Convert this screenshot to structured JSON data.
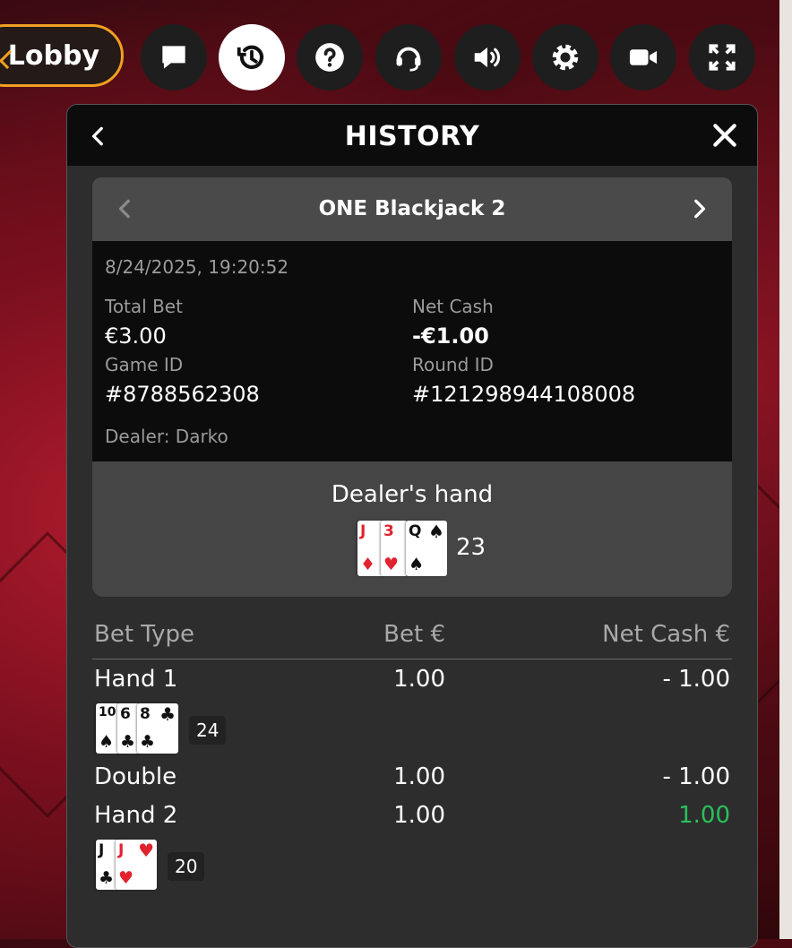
{
  "topbar": {
    "lobby_label": "Lobby",
    "buttons": [
      {
        "icon": "chat-icon"
      },
      {
        "icon": "history-icon",
        "active": true
      },
      {
        "icon": "help-icon"
      },
      {
        "icon": "headset-icon"
      },
      {
        "icon": "volume-icon"
      },
      {
        "icon": "settings-icon"
      },
      {
        "icon": "video-icon"
      },
      {
        "icon": "fullscreen-icon"
      }
    ]
  },
  "panel": {
    "title": "HISTORY",
    "game_name": "ONE Blackjack 2",
    "datetime": "8/24/2025, 19:20:52",
    "total_bet_label": "Total Bet",
    "total_bet_value": "€3.00",
    "net_cash_label": "Net Cash",
    "net_cash_value": "-€1.00",
    "game_id_label": "Game ID",
    "game_id_value": "#8788562308",
    "round_id_label": "Round ID",
    "round_id_value": "#121298944108008",
    "dealer": "Dealer: Darko",
    "dealer_hand_title": "Dealer's hand",
    "dealer_cards": [
      {
        "rank": "J",
        "suit": "♦",
        "color": "red"
      },
      {
        "rank": "3",
        "suit": "♥",
        "color": "red"
      },
      {
        "rank": "Q",
        "suit": "♠",
        "color": "black"
      }
    ],
    "dealer_score": "23"
  },
  "table": {
    "headers": {
      "bet_type": "Bet Type",
      "bet": "Bet €",
      "net_cash": "Net Cash €"
    },
    "rows": [
      {
        "bet_type": "Hand 1",
        "bet": "1.00",
        "net": "- 1.00",
        "win": false
      },
      {
        "bet_type": "Double",
        "bet": "1.00",
        "net": "- 1.00",
        "win": false
      },
      {
        "bet_type": "Hand 2",
        "bet": "1.00",
        "net": "1.00",
        "win": true
      }
    ],
    "hand1_cards": [
      {
        "rank": "10",
        "suit": "♠",
        "color": "black"
      },
      {
        "rank": "6",
        "suit": "♣",
        "color": "black"
      },
      {
        "rank": "8",
        "suit": "♣",
        "color": "black"
      }
    ],
    "hand1_score": "24",
    "hand2_cards": [
      {
        "rank": "J",
        "suit": "♣",
        "color": "black"
      },
      {
        "rank": "J",
        "suit": "♥",
        "color": "red"
      }
    ],
    "hand2_score": "20"
  },
  "colors": {
    "accent": "#f0a020",
    "win": "#27c25a",
    "panel_bg": "#2d2d2d",
    "header_bg": "#0c0c0c"
  }
}
